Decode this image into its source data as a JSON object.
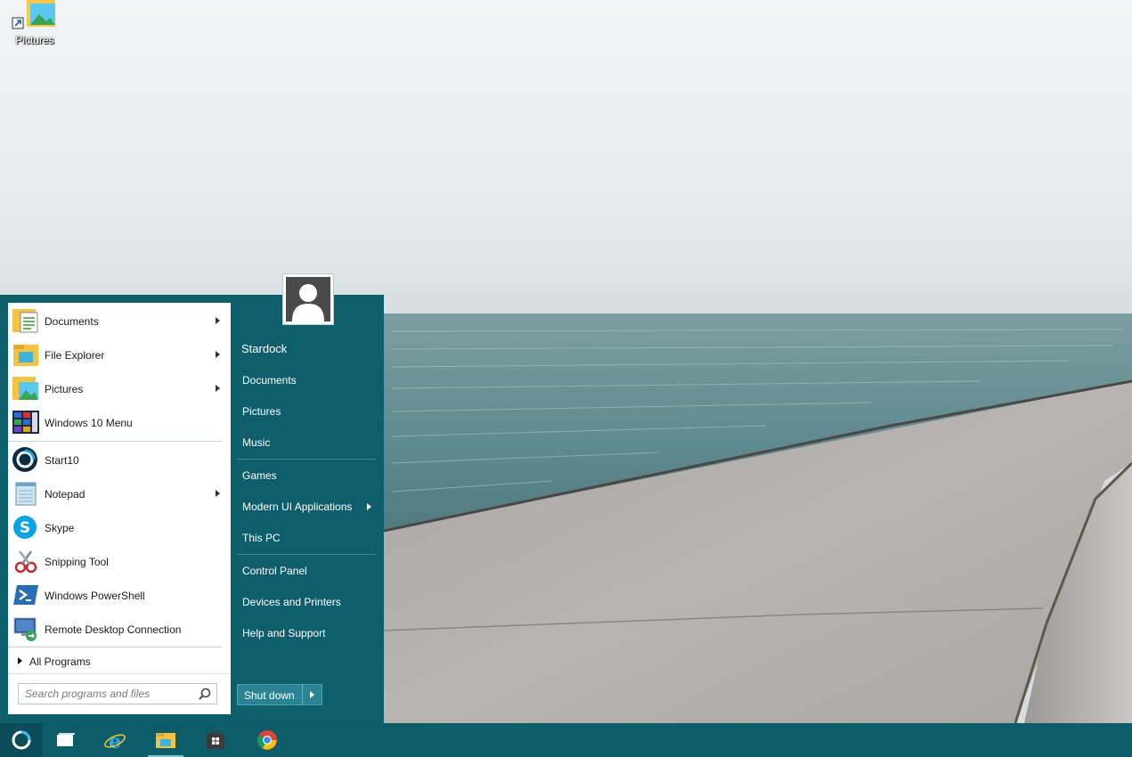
{
  "desktop": {
    "icons": [
      {
        "label": "Pictures",
        "icon": "pictures-shortcut-icon"
      }
    ]
  },
  "start_menu": {
    "pinned": [
      {
        "label": "Documents",
        "icon": "documents-folder-icon",
        "submenu": true
      },
      {
        "label": "File Explorer",
        "icon": "file-explorer-icon",
        "submenu": true
      },
      {
        "label": "Pictures",
        "icon": "pictures-folder-icon",
        "submenu": true
      },
      {
        "label": "Windows 10 Menu",
        "icon": "windows10-menu-icon",
        "submenu": false
      }
    ],
    "recent": [
      {
        "label": "Start10",
        "icon": "start10-icon",
        "submenu": false
      },
      {
        "label": "Notepad",
        "icon": "notepad-icon",
        "submenu": true
      },
      {
        "label": "Skype",
        "icon": "skype-icon",
        "submenu": false
      },
      {
        "label": "Snipping Tool",
        "icon": "snipping-tool-icon",
        "submenu": false
      },
      {
        "label": "Windows PowerShell",
        "icon": "powershell-icon",
        "submenu": false
      },
      {
        "label": "Remote Desktop Connection",
        "icon": "remote-desktop-icon",
        "submenu": false
      }
    ],
    "all_programs_label": "All Programs",
    "search": {
      "placeholder": "Search programs and files",
      "value": ""
    },
    "user": {
      "name": "Stardock",
      "avatar": "user-avatar-icon"
    },
    "right_links": [
      {
        "label": "Documents",
        "submenu": false
      },
      {
        "label": "Pictures",
        "submenu": false
      },
      {
        "label": "Music",
        "submenu": false
      },
      {
        "label": "Games",
        "submenu": false
      },
      {
        "label": "Modern UI Applications",
        "submenu": true
      },
      {
        "label": "This PC",
        "submenu": false
      },
      {
        "label": "Control Panel",
        "submenu": false
      },
      {
        "label": "Devices and Printers",
        "submenu": false
      },
      {
        "label": "Help and Support",
        "submenu": false
      }
    ],
    "shutdown_label": "Shut down"
  },
  "taskbar": {
    "items": [
      {
        "name": "start-button",
        "icon": "start10-orb-icon"
      },
      {
        "name": "task-view",
        "icon": "task-view-icon"
      },
      {
        "name": "internet-explorer",
        "icon": "internet-explorer-icon"
      },
      {
        "name": "file-explorer",
        "icon": "file-explorer-icon"
      },
      {
        "name": "store",
        "icon": "store-icon"
      },
      {
        "name": "chrome",
        "icon": "chrome-icon"
      }
    ]
  },
  "colors": {
    "menu_teal": "#0f5e6b",
    "taskbar_teal": "#0d5d69",
    "shutdown_button": "#2b8494",
    "menu_text": "#ffffff"
  }
}
